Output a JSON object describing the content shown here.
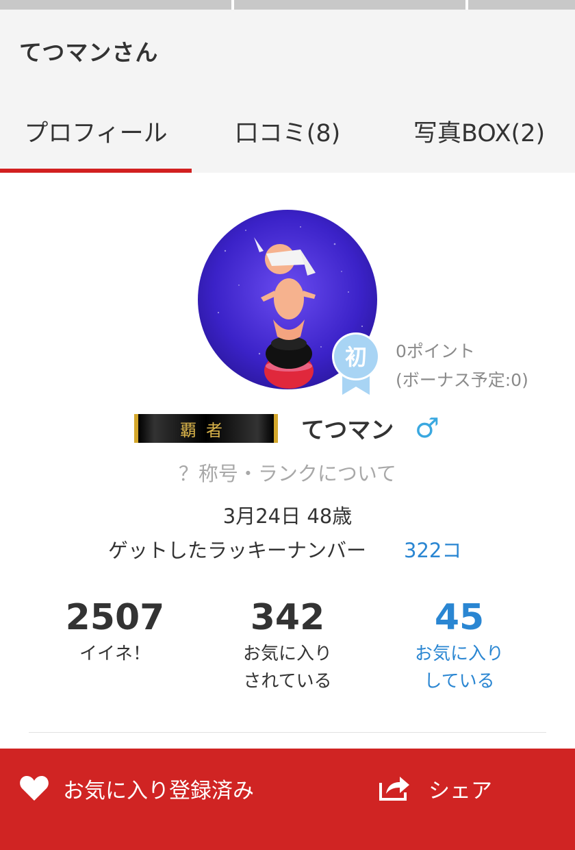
{
  "header": {
    "title": "てつマンさん",
    "tabs": [
      {
        "label": "プロフィール",
        "active": true
      },
      {
        "label": "口コミ(8)",
        "active": false
      },
      {
        "label": "写真BOX(2)",
        "active": false
      }
    ]
  },
  "profile": {
    "badge_label": "初",
    "points": "0ポイント",
    "bonus": "(ボーナス予定:0)",
    "rank_title": "覇者",
    "user_name": "てつマン",
    "gender_icon": "male-icon",
    "rank_link": "？称号・ランクについて",
    "birth": "3月24日 48歳",
    "lucky_label": "ゲットしたラッキーナンバー",
    "lucky_value": "322コ"
  },
  "stats": [
    {
      "value": "2507",
      "label_line1": "イイネ！",
      "label_line2": ""
    },
    {
      "value": "342",
      "label_line1": "お気に入り",
      "label_line2": "されている"
    },
    {
      "value": "45",
      "label_line1": "お気に入り",
      "label_line2": "している"
    }
  ],
  "bottom_bar": {
    "favorite_label": "お気に入り登録済み",
    "share_label": "シェア"
  },
  "colors": {
    "accent_red": "#d02423",
    "link_blue": "#2a86d2",
    "gender_blue": "#3aa8e0",
    "badge_blue": "#a8d4f4"
  }
}
